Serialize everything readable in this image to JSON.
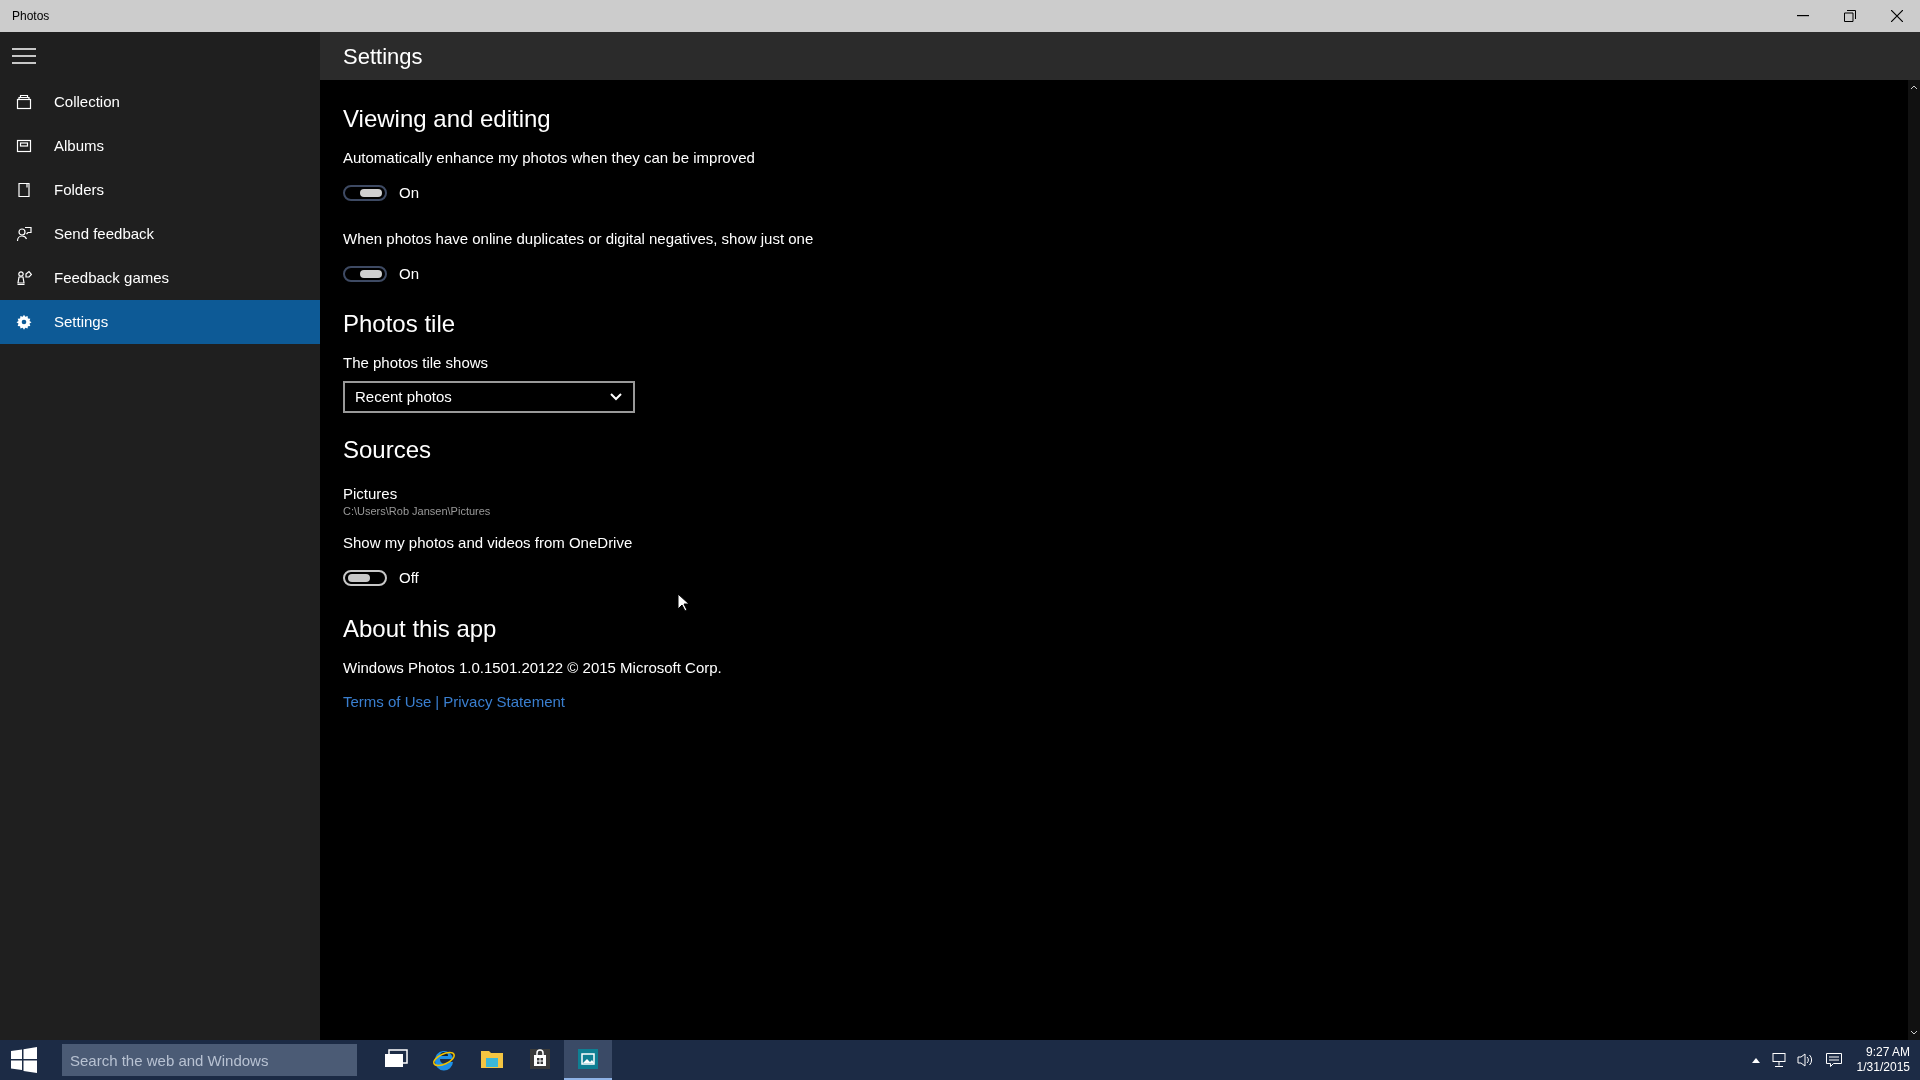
{
  "window": {
    "title": "Photos"
  },
  "nav": {
    "items": [
      {
        "label": "Collection",
        "selected": false
      },
      {
        "label": "Albums",
        "selected": false
      },
      {
        "label": "Folders",
        "selected": false
      },
      {
        "label": "Send feedback",
        "selected": false
      },
      {
        "label": "Feedback games",
        "selected": false
      },
      {
        "label": "Settings",
        "selected": true
      }
    ]
  },
  "page": {
    "title": "Settings"
  },
  "sections": [
    {
      "heading": "Viewing and editing",
      "items": [
        {
          "kind": "toggle",
          "label": "Automatically enhance my photos when they can be improved",
          "on": true,
          "state_text": "On"
        },
        {
          "kind": "toggle",
          "label": "When photos have online duplicates or digital negatives, show just one",
          "on": true,
          "state_text": "On"
        }
      ]
    },
    {
      "heading": "Photos tile",
      "items": [
        {
          "kind": "dropdown",
          "label": "The photos tile shows",
          "value": "Recent photos"
        }
      ]
    },
    {
      "heading": "Sources",
      "items": [
        {
          "kind": "folder",
          "name": "Pictures",
          "path": "C:\\Users\\Rob Jansen\\Pictures"
        },
        {
          "kind": "toggle",
          "label": "Show my photos and videos from OneDrive",
          "on": false,
          "state_text": "Off"
        }
      ]
    },
    {
      "heading": "About this app",
      "items": [
        {
          "kind": "text",
          "text": "Windows Photos 1.0.1501.20122 © 2015 Microsoft Corp."
        },
        {
          "kind": "links",
          "links": [
            "Terms of Use",
            "Privacy Statement"
          ],
          "separator": "|"
        }
      ]
    }
  ],
  "taskbar": {
    "search": {
      "placeholder": "Search the web and Windows"
    },
    "apps": [
      {
        "selected": false
      },
      {
        "selected": false
      },
      {
        "selected": false
      },
      {
        "selected": false
      },
      {
        "selected": true
      }
    ],
    "clock": {
      "time": "9:27 AM",
      "date": "1/31/2015"
    }
  }
}
